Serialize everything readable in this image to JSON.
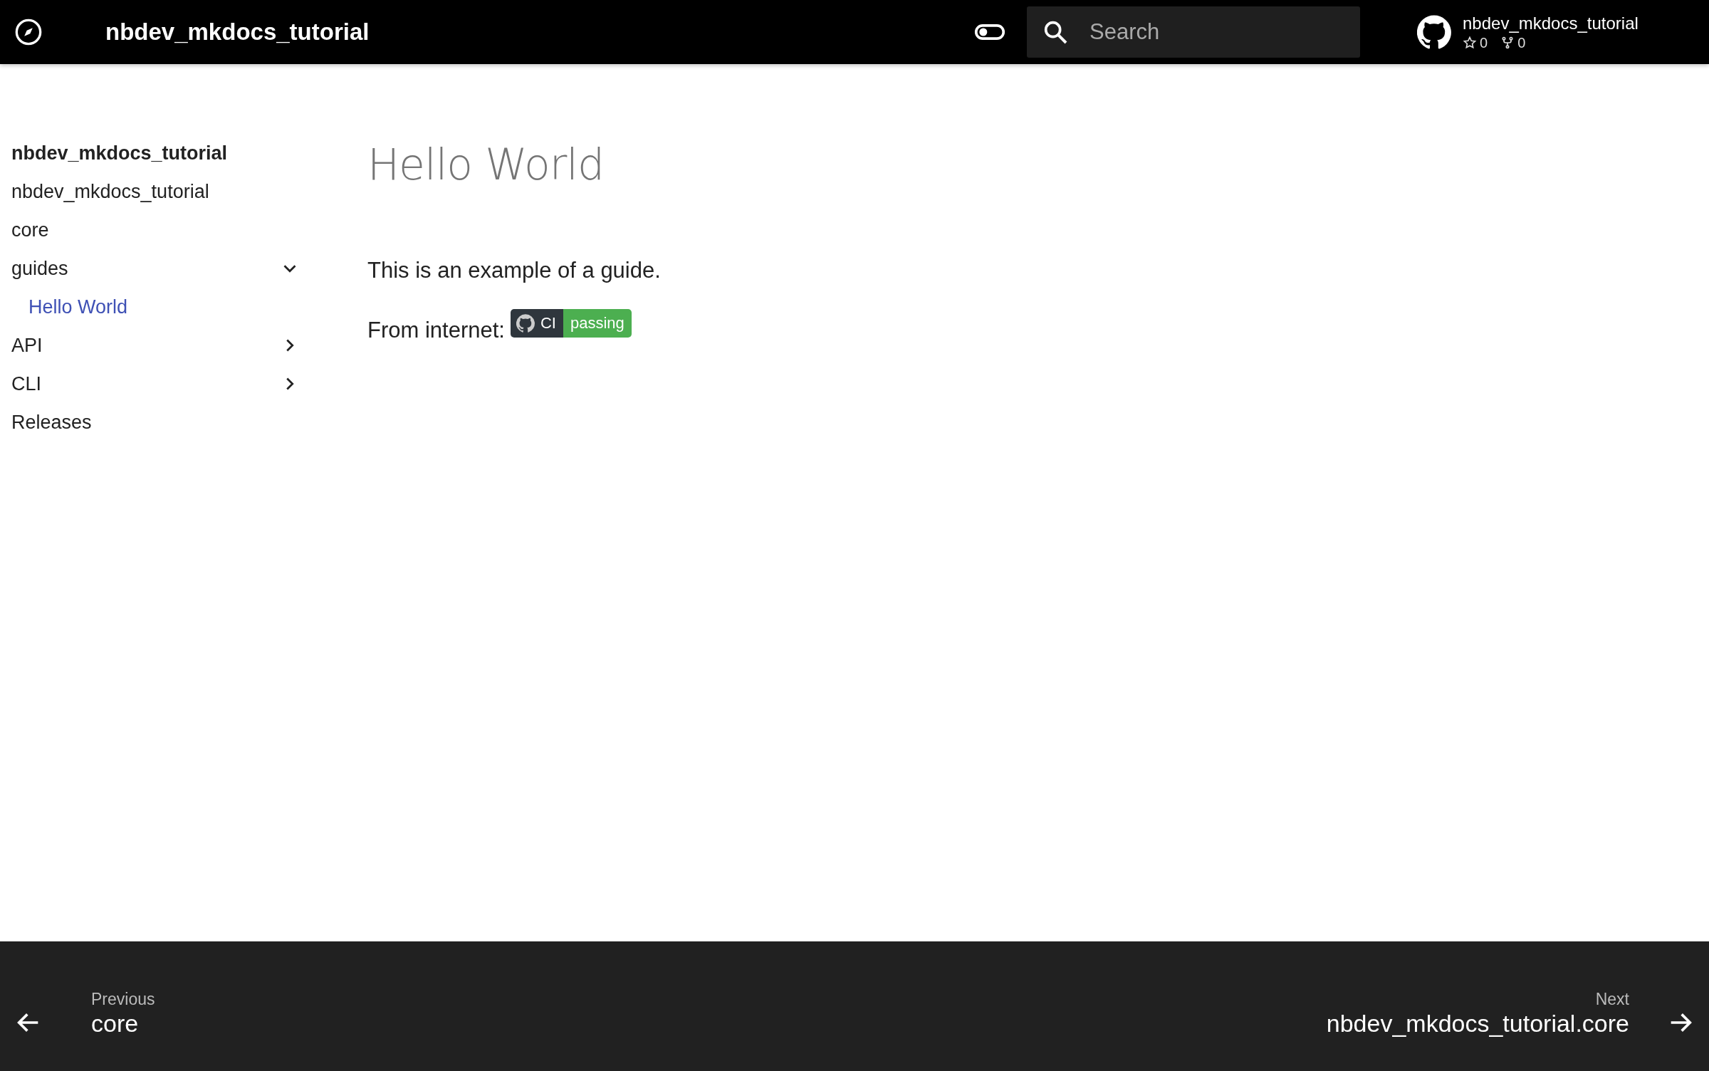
{
  "header": {
    "title": "nbdev_mkdocs_tutorial",
    "search": {
      "placeholder": "Search"
    },
    "repo": {
      "name": "nbdev_mkdocs_tutorial",
      "stars": "0",
      "forks": "0"
    }
  },
  "nav": {
    "title": "nbdev_mkdocs_tutorial",
    "items": [
      {
        "label": "nbdev_mkdocs_tutorial",
        "selected": false
      },
      {
        "label": "core",
        "selected": false
      },
      {
        "label": "guides",
        "selected": false,
        "expanded": true,
        "children": [
          {
            "label": "Hello World",
            "selected": true
          }
        ]
      },
      {
        "label": "API",
        "selected": false,
        "expanded": false
      },
      {
        "label": "CLI",
        "selected": false,
        "expanded": false
      },
      {
        "label": "Releases",
        "selected": false
      }
    ]
  },
  "content": {
    "title": "Hello World",
    "paragraphs": [
      "This is an example of a guide."
    ],
    "badge_line": {
      "text": "From internet:",
      "badge_label": "CI",
      "badge_status": "passing"
    }
  },
  "footer": {
    "previous": {
      "direction": "Previous",
      "title": "core"
    },
    "next": {
      "direction": "Next",
      "title": "nbdev_mkdocs_tutorial.core"
    }
  }
}
